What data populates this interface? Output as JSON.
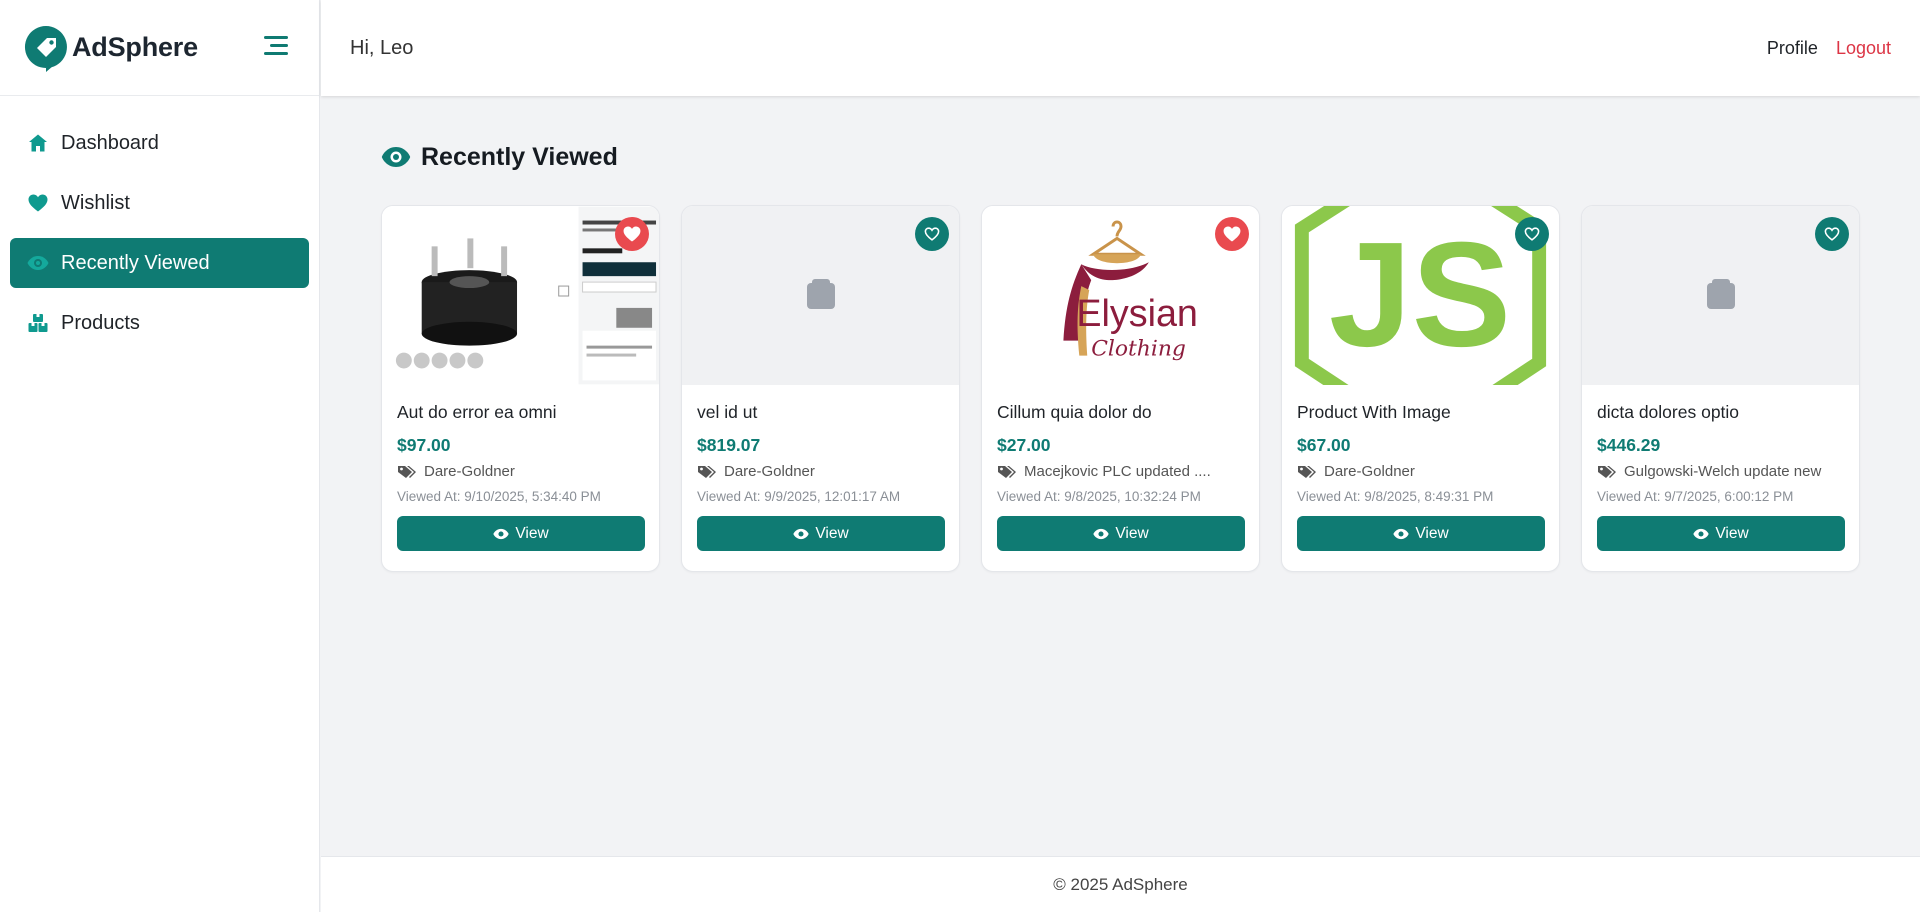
{
  "brand": {
    "name": "AdSphere",
    "accent": "#0f7b73"
  },
  "header": {
    "greeting": "Hi, Leo",
    "profile_label": "Profile",
    "logout_label": "Logout"
  },
  "sidebar": {
    "items": [
      {
        "label": "Dashboard",
        "icon": "home-icon",
        "active": false
      },
      {
        "label": "Wishlist",
        "icon": "heart-icon",
        "active": false
      },
      {
        "label": "Recently Viewed",
        "icon": "eye-icon",
        "active": true
      },
      {
        "label": "Products",
        "icon": "boxes-icon",
        "active": false
      }
    ]
  },
  "main": {
    "title": "Recently Viewed",
    "view_label": "View",
    "cards": [
      {
        "name": "Aut do error ea omni",
        "price": "$97.00",
        "vendor": "Dare-Goldner",
        "viewed": "Viewed At: 9/10/2025, 5:34:40 PM",
        "favorite": true,
        "image": "wheel-spacer-photo"
      },
      {
        "name": "vel id ut",
        "price": "$819.07",
        "vendor": "Dare-Goldner",
        "viewed": "Viewed At: 9/9/2025, 12:01:17 AM",
        "favorite": false,
        "image": "placeholder"
      },
      {
        "name": "Cillum quia dolor do",
        "price": "$27.00",
        "vendor": "Macejkovic PLC updated ....",
        "viewed": "Viewed At: 9/8/2025, 10:32:24 PM",
        "favorite": true,
        "image": "elysian-clothing-logo",
        "image_text": [
          "Elysian",
          "Clothing"
        ]
      },
      {
        "name": "Product With Image",
        "price": "$67.00",
        "vendor": "Dare-Goldner",
        "viewed": "Viewed At: 9/8/2025, 8:49:31 PM",
        "favorite": false,
        "image": "nodejs-logo",
        "image_text": [
          "JS"
        ]
      },
      {
        "name": "dicta dolores optio",
        "price": "$446.29",
        "vendor": "Gulgowski-Welch update new",
        "viewed": "Viewed At: 9/7/2025, 6:00:12 PM",
        "favorite": false,
        "image": "placeholder"
      }
    ]
  },
  "footer": {
    "text": "© 2025 AdSphere"
  },
  "colors": {
    "favorite": "#e94a4f",
    "logout": "#dc3545"
  }
}
